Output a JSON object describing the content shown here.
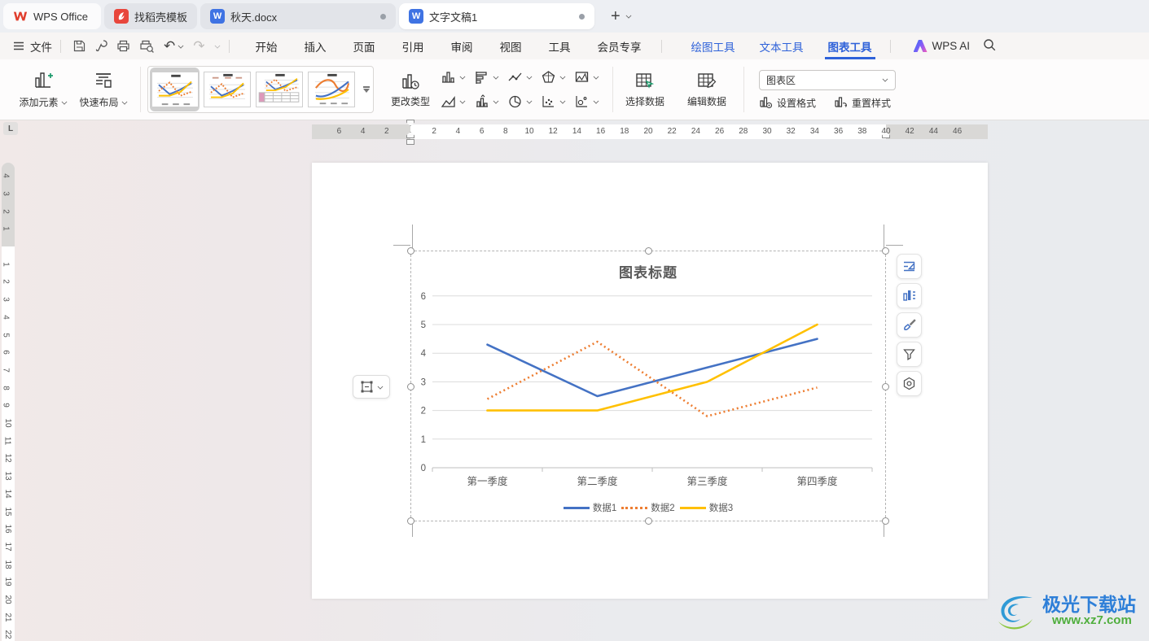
{
  "tabbar": {
    "tabs": [
      {
        "label": "WPS Office"
      },
      {
        "label": "找稻壳模板"
      },
      {
        "label": "秋天.docx"
      },
      {
        "label": "文字文稿1"
      }
    ]
  },
  "menubar": {
    "file_label": "文件",
    "items": [
      "开始",
      "插入",
      "页面",
      "引用",
      "审阅",
      "视图",
      "工具",
      "会员专享"
    ],
    "tool_tabs": [
      "绘图工具",
      "文本工具",
      "图表工具"
    ],
    "wps_ai_label": "WPS AI"
  },
  "ribbon": {
    "add_element": "添加元素",
    "quick_layout": "快速布局",
    "change_type": "更改类型",
    "select_data": "选择数据",
    "edit_data": "编辑数据",
    "element_selector_value": "图表区",
    "set_format": "设置格式",
    "reset_style": "重置样式"
  },
  "ruler": {
    "h_left_numbers": [
      6,
      4,
      2
    ],
    "h_right_numbers": [
      2,
      4,
      6,
      8,
      10,
      12,
      14,
      16,
      18,
      20,
      22,
      24,
      26,
      28,
      30,
      32,
      34,
      36,
      38,
      40,
      42,
      44,
      46
    ],
    "v_top_numbers": [
      4,
      3,
      2,
      1
    ],
    "v_bottom_numbers": [
      1,
      2,
      3,
      4,
      5,
      6,
      7,
      8,
      9,
      10,
      11,
      12,
      13,
      14,
      15,
      16,
      17,
      18,
      19,
      20,
      21,
      22
    ]
  },
  "chart_data": {
    "type": "line",
    "title": "图表标题",
    "categories": [
      "第一季度",
      "第二季度",
      "第三季度",
      "第四季度"
    ],
    "series": [
      {
        "name": "数据1",
        "values": [
          4.3,
          2.5,
          3.5,
          4.5
        ],
        "color": "#4472C4",
        "dash": "solid"
      },
      {
        "name": "数据2",
        "values": [
          2.4,
          4.4,
          1.8,
          2.8
        ],
        "color": "#ED7D31",
        "dash": "dotted"
      },
      {
        "name": "数据3",
        "values": [
          2.0,
          2.0,
          3.0,
          5.0
        ],
        "color": "#FFC000",
        "dash": "solid"
      }
    ],
    "ylim": [
      0,
      6
    ],
    "y_ticks": [
      0,
      1,
      2,
      3,
      4,
      5,
      6
    ],
    "grid": true,
    "legend_position": "bottom"
  },
  "watermark": {
    "site": "极光下载站",
    "url": "www.xz7.com"
  },
  "colors": {
    "accent_blue": "#2F62D9",
    "series_blue": "#4472C4",
    "series_orange": "#ED7D31",
    "series_gold": "#FFC000",
    "grid_gray": "#dcdcdc",
    "axis_gray": "#bfbfbf",
    "chart_text": "#595959"
  }
}
